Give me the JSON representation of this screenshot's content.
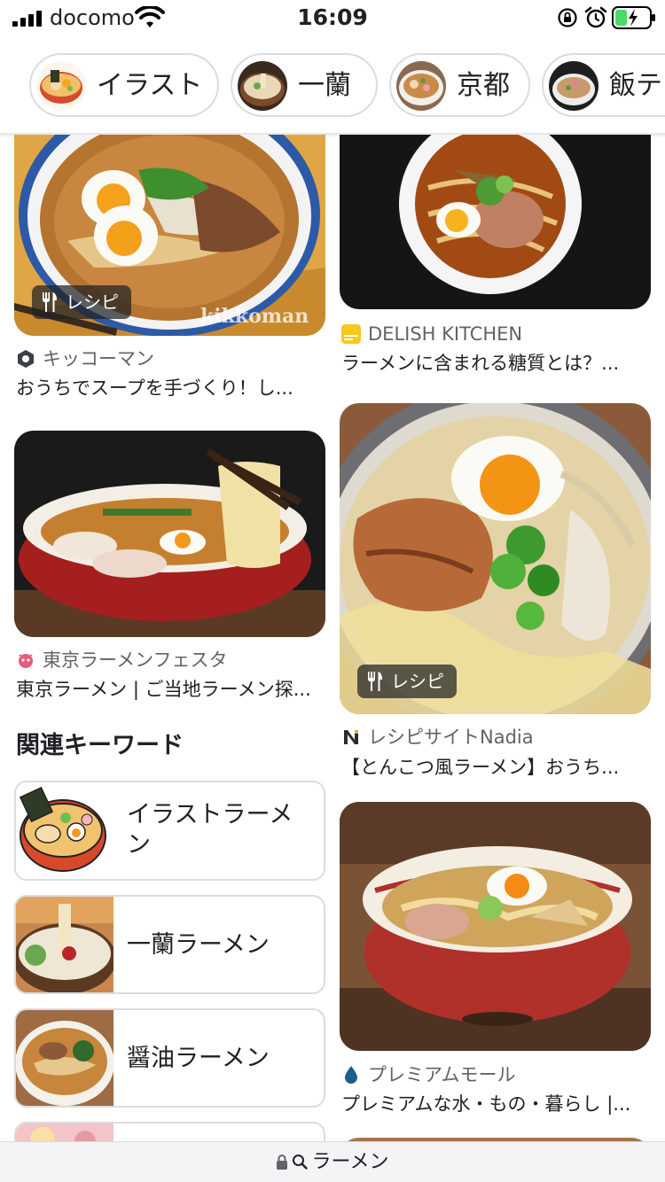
{
  "status_bar": {
    "carrier": "docomo",
    "time": "16:09",
    "battery_color": "#4cd964"
  },
  "chips": [
    {
      "label": "イラスト"
    },
    {
      "label": "一蘭"
    },
    {
      "label": "京都"
    },
    {
      "label": "飯テ"
    }
  ],
  "results": {
    "left": [
      {
        "badge": "レシピ",
        "watermark": "kikkoman",
        "source": "キッコーマン",
        "title": "おうちでスープを手づくり！し..."
      },
      {
        "source": "東京ラーメンフェスタ",
        "title": "東京ラーメン | ご当地ラーメン探..."
      }
    ],
    "right": [
      {
        "source": "DELISH KITCHEN",
        "title": "ラーメンに含まれる糖質とは？..."
      },
      {
        "badge": "レシピ",
        "source": "レシピサイトNadia",
        "title": "【とんこつ風ラーメン】おうち..."
      },
      {
        "source": "プレミアムモール",
        "title": "プレミアムな水・もの・暮らし |..."
      }
    ]
  },
  "related": {
    "heading": "関連キーワード",
    "items": [
      {
        "line1": "イラストラーメ",
        "line2": "ン"
      },
      {
        "label": "一蘭ラーメン"
      },
      {
        "label": "醤油ラーメン"
      }
    ]
  },
  "url_bar": {
    "query": "ラーメン"
  },
  "icons": [
    "signal-icon",
    "wifi-icon",
    "rotation-lock-icon",
    "alarm-icon",
    "battery-icon",
    "fork-knife-icon",
    "lock-icon",
    "search-icon"
  ]
}
